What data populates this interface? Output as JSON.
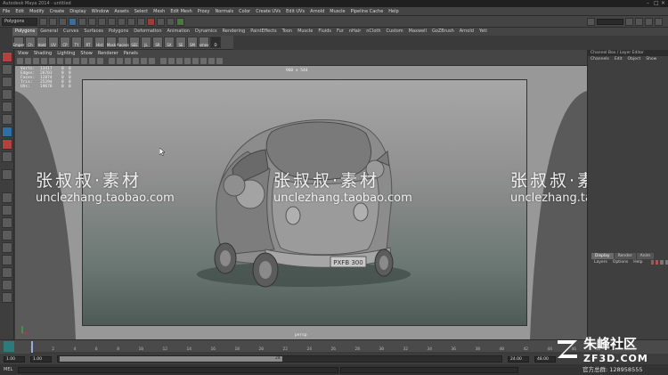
{
  "window": {
    "title": "Autodesk Maya 2014 · untitled"
  },
  "menubar": [
    "File",
    "Edit",
    "Modify",
    "Create",
    "Display",
    "Window",
    "Assets",
    "Select",
    "Mesh",
    "Edit Mesh",
    "Proxy",
    "Normals",
    "Color",
    "Create UVs",
    "Edit UVs",
    "Arnold",
    "Muscle",
    "Pipeline Cache",
    "Help"
  ],
  "status_line": {
    "mode": "Polygons"
  },
  "shelf_tabs": [
    "Polygons",
    "General",
    "Curves",
    "Surfaces",
    "Polygons",
    "Deformation",
    "Animation",
    "Dynamics",
    "Rendering",
    "PaintEffects",
    "Toon",
    "Muscle",
    "Fluids",
    "Fur",
    "nHair",
    "nCloth",
    "Custom",
    "Maxwell",
    "GoZBrush",
    "Arnold",
    "Yeti"
  ],
  "shelf_icons": [
    "Emper",
    "Ch",
    "Hold",
    "UV",
    "CP",
    "TY",
    "RT",
    "Hist",
    "Mask",
    "Aacess",
    "SEE",
    "JL",
    "SR",
    "SX",
    "SE",
    "SM",
    "xmov",
    "D"
  ],
  "viewport": {
    "menu": [
      "View",
      "Shading",
      "Lighting",
      "Show",
      "Renderer",
      "Panels"
    ],
    "resolution": "960 x 544",
    "camera": "persp",
    "hud": [
      {
        "label": "Verts:",
        "a": "13417",
        "b": "0",
        "c": "0"
      },
      {
        "label": "Edges:",
        "a": "26703",
        "b": "0",
        "c": "0"
      },
      {
        "label": "Faces:",
        "a": "12874",
        "b": "0",
        "c": "0"
      },
      {
        "label": "Tris:",
        "a": "25294",
        "b": "0",
        "c": "0"
      },
      {
        "label": "UVs:",
        "a": "19678",
        "b": "0",
        "c": "0"
      }
    ],
    "license_plate": "PXFB 300"
  },
  "channel_box": {
    "title": "Channel Box / Layer Editor",
    "menu": [
      "Channels",
      "Edit",
      "Object",
      "Show"
    ],
    "layer_tabs": [
      "Display",
      "Render",
      "Anim"
    ],
    "layer_menu": [
      "Layers",
      "Options",
      "Help"
    ]
  },
  "time_slider": {
    "ticks": [
      "1",
      "2",
      "4",
      "6",
      "8",
      "10",
      "12",
      "14",
      "16",
      "18",
      "20",
      "22",
      "24",
      "26",
      "28",
      "30",
      "32",
      "34",
      "36",
      "38",
      "40",
      "42",
      "44",
      "46",
      "48"
    ],
    "current_frame": "1.00"
  },
  "range_slider": {
    "start": "1.00",
    "range_start": "1.00",
    "range_mid": "24",
    "range_end": "24.00",
    "end": "48.00"
  },
  "command_line": {
    "label": "MEL"
  },
  "watermark": {
    "text_cn": "张叔叔·素材",
    "url": "unclezhang.taobao.com"
  },
  "site_logo": {
    "name_cn": "朱峰社区",
    "domain": "ZF3D.COM",
    "qq": "官方总群: 128958555"
  },
  "colors": {
    "viewport_bg": "#989898",
    "accent_selected": "#2e6fa5",
    "toolbox_red": "#b3413f"
  }
}
